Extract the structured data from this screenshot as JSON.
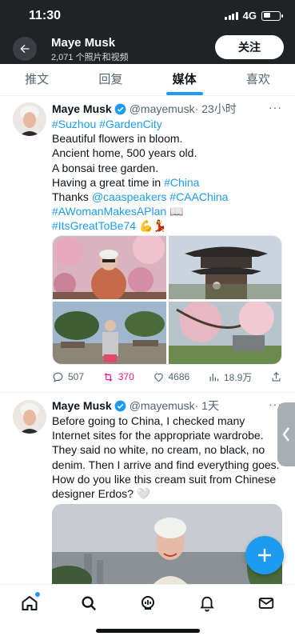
{
  "status_bar": {
    "time": "11:30",
    "network": "4G"
  },
  "header": {
    "name": "Maye Musk",
    "subtitle": "2,071 个照片和视频",
    "follow_label": "关注"
  },
  "tabs": [
    {
      "label": "推文",
      "active": false
    },
    {
      "label": "回复",
      "active": false
    },
    {
      "label": "媒体",
      "active": true
    },
    {
      "label": "喜欢",
      "active": false
    }
  ],
  "tweets": [
    {
      "name": "Maye Musk",
      "handle": "@mayemusk",
      "time": "· 23小时",
      "lines": [
        {
          "parts": [
            {
              "t": "#Suzhou #GardenCity",
              "link": true
            }
          ]
        },
        {
          "parts": [
            {
              "t": "Beautiful flowers in bloom.",
              "link": false
            }
          ]
        },
        {
          "parts": [
            {
              "t": "Ancient home, 500 years old.",
              "link": false
            }
          ]
        },
        {
          "parts": [
            {
              "t": "A bonsai tree garden.",
              "link": false
            }
          ]
        },
        {
          "parts": [
            {
              "t": "Having a great time in ",
              "link": false
            },
            {
              "t": "#China",
              "link": true
            }
          ]
        },
        {
          "parts": [
            {
              "t": "Thanks ",
              "link": false
            },
            {
              "t": "@caaspeakers #CAAChina",
              "link": true
            }
          ]
        },
        {
          "parts": [
            {
              "t": "#AWomanMakesAPlan",
              "link": true
            },
            {
              "t": " 📖",
              "link": false
            }
          ]
        },
        {
          "parts": [
            {
              "t": "#ItsGreatToBe74",
              "link": true
            },
            {
              "t": " 💪💃",
              "link": false
            }
          ]
        }
      ],
      "stats": {
        "replies": "507",
        "retweets": "370",
        "likes": "4686",
        "views": "18.9万"
      }
    },
    {
      "name": "Maye Musk",
      "handle": "@mayemusk",
      "time": "· 1天",
      "lines": [
        {
          "parts": [
            {
              "t": "Before going to China, I checked many",
              "link": false
            }
          ]
        },
        {
          "parts": [
            {
              "t": "Internet sites for the appropriate wardrobe.",
              "link": false
            }
          ]
        },
        {
          "parts": [
            {
              "t": "They said no white, no cream, no black, no",
              "link": false
            }
          ]
        },
        {
          "parts": [
            {
              "t": "denim. Then I arrive and find everything goes.",
              "link": false
            }
          ]
        },
        {
          "parts": [
            {
              "t": "How do you like this cream suit from Chinese",
              "link": false
            }
          ]
        },
        {
          "parts": [
            {
              "t": "designer Erdos? 🤍",
              "link": false
            }
          ]
        }
      ]
    }
  ],
  "bottom_nav": [
    {
      "name": "home-icon",
      "badge": true
    },
    {
      "name": "search-icon",
      "badge": false
    },
    {
      "name": "spaces-icon",
      "badge": false
    },
    {
      "name": "notifications-icon",
      "badge": false
    },
    {
      "name": "messages-icon",
      "badge": false
    }
  ],
  "colors": {
    "accent": "#1d9bf0",
    "header_bg": "#1f2326",
    "retweet": "#f91880"
  }
}
